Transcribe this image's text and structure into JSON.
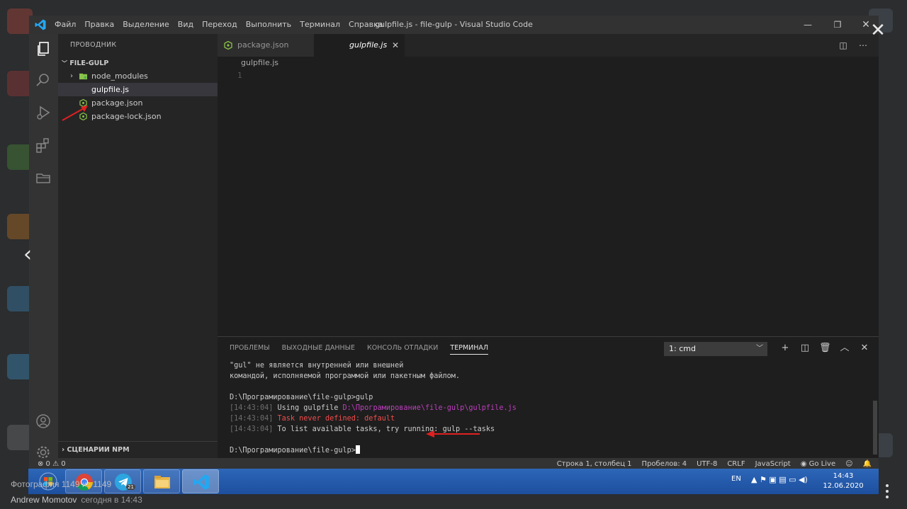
{
  "window": {
    "title": "gulpfile.js - file-gulp - Visual Studio Code",
    "menu": [
      "Файл",
      "Правка",
      "Выделение",
      "Вид",
      "Переход",
      "Выполнить",
      "Терминал",
      "Справка"
    ]
  },
  "explorer": {
    "header": "ПРОВОДНИК",
    "folder": "FILE-GULP",
    "items": [
      {
        "label": "node_modules",
        "icon": "folder-icon"
      },
      {
        "label": "gulpfile.js",
        "icon": "js-icon",
        "selected": true
      },
      {
        "label": "package.json",
        "icon": "npm-json-icon"
      },
      {
        "label": "package-lock.json",
        "icon": "npm-json-icon"
      }
    ],
    "npm_section": "СЦЕНАРИИ NPM"
  },
  "editor": {
    "tabs": [
      {
        "label": "package.json",
        "icon": "npm-json-icon"
      },
      {
        "label": "gulpfile.js",
        "active": true
      }
    ],
    "breadcrumb": "gulpfile.js",
    "line_number": "1"
  },
  "panel": {
    "tabs": [
      "ПРОБЛЕМЫ",
      "ВЫХОДНЫЕ ДАННЫЕ",
      "КОНСОЛЬ ОТЛАДКИ",
      "ТЕРМИНАЛ"
    ],
    "active_tab": "ТЕРМИНАЛ",
    "terminal_select": "1: cmd",
    "terminal": {
      "l1": "\"gul\" не является внутренней или внешней",
      "l2": "командой, исполняемой программой или пакетным файлом.",
      "prompt1": "D:\\Програмирование\\file-gulp>gulp",
      "ts": "14:43:04",
      "using": "Using gulpfile",
      "gulpfile_path": "D:\\Програмирование\\file-gulp\\gulpfile.js",
      "error": "Task never defined: default",
      "hint": "To list available tasks, try running: gulp --tasks",
      "prompt2": "D:\\Програмирование\\file-gulp>"
    }
  },
  "statusbar": {
    "problems": "⊗ 0 ⚠ 0",
    "position": "Строка 1, столбец 1",
    "spaces": "Пробелов: 4",
    "encoding": "UTF-8",
    "eol": "CRLF",
    "language": "JavaScript",
    "golive": "Go Live"
  },
  "taskbar": {
    "lang": "EN",
    "time": "14:43",
    "date": "12.06.2020",
    "telegram_badge": "21"
  },
  "viewer": {
    "counter": "Фотография 1149 из 1149",
    "author": "Andrew Momotov",
    "time": "сегодня в 14:43"
  },
  "colors": {
    "accent_blue": "#007acc",
    "error_red": "#f14c4c",
    "path_magenta": "#bc3fbc",
    "annotation_red": "#e02020"
  }
}
